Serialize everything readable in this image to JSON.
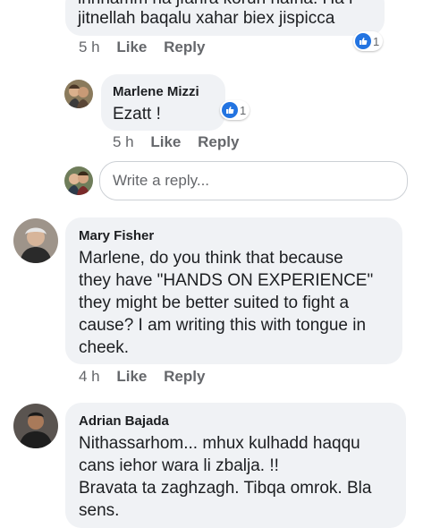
{
  "comments": [
    {
      "text_lines": [
        "innhamm ha jfahra koruh nafha. Ha l",
        "jitnellah baqalu xahar biex jispicca"
      ],
      "time": "5 h",
      "like_label": "Like",
      "reply_label": "Reply",
      "reactions": "1"
    },
    {
      "author": "Marlene Mizzi",
      "text": "Ezatt !",
      "time": "5 h",
      "like_label": "Like",
      "reply_label": "Reply",
      "reactions": "1"
    },
    {
      "author": "Mary Fisher",
      "text_lines": [
        "Marlene, do you think that because",
        "they have \"HANDS ON EXPERIENCE\"",
        "they might be better suited to fight a",
        "cause? I am writing this with tongue in",
        "cheek."
      ],
      "time": "4 h",
      "like_label": "Like",
      "reply_label": "Reply"
    },
    {
      "author": "Adrian Bajada",
      "text_lines": [
        "Nithassarhom... mhux kulhadd haqqu",
        "cans iehor wara li zbalja. !!",
        "Bravata ta zaghzagh. Tibqa omrok. Bla",
        "sens."
      ]
    }
  ],
  "reply_input": {
    "placeholder": "Write a reply..."
  },
  "colors": {
    "bubble": "#f0f2f5",
    "like_blue": "#2374e1",
    "meta": "#65676b"
  },
  "icons": {
    "reaction": "like-thumb-icon"
  }
}
